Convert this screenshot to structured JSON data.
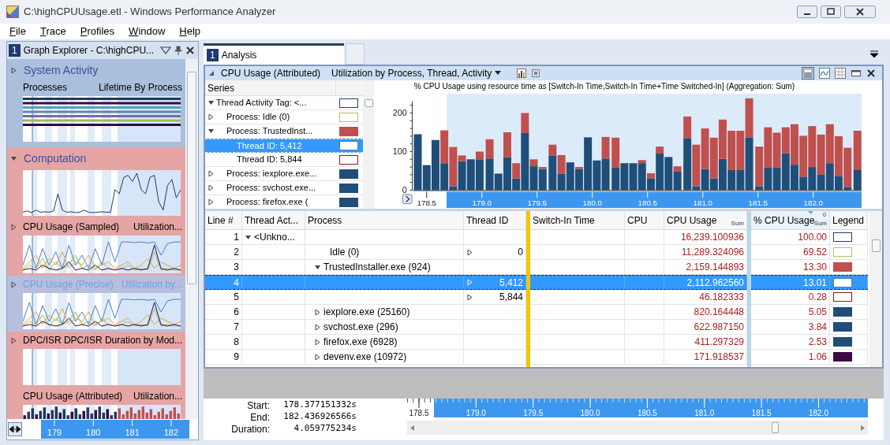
{
  "window": {
    "title": "C:\\highCPUUsage.etl - Windows Performance Analyzer"
  },
  "menu": [
    "File",
    "Trace",
    "Profiles",
    "Window",
    "Help"
  ],
  "graph_explorer": {
    "number": "1",
    "title": "Graph Explorer - C:\\highCPU...",
    "groups": [
      {
        "title": "System Activity",
        "expanded": false,
        "color": "#a9bfdc",
        "graphs": [
          {
            "name": "Processes",
            "preset": "Lifetime By Process",
            "expandable": false,
            "selected": false,
            "kind": "lifetime"
          }
        ]
      },
      {
        "title": "Computation",
        "expanded": true,
        "color": "#e6a5a5",
        "graphs": [
          {
            "expandable": false,
            "selected": false,
            "kind": "line"
          },
          {
            "name": "CPU Usage (Sampled)",
            "preset": "Utilization...",
            "expandable": true,
            "selected": false,
            "kind": "multiline"
          },
          {
            "name": "CPU Usage (Precise)",
            "preset": "Utilization by...",
            "expandable": true,
            "selected": true,
            "kind": "multiline"
          },
          {
            "name": "DPC/ISR",
            "preset": "DPC/ISR Duration by Mod...",
            "expandable": true,
            "selected": false,
            "kind": "empty"
          },
          {
            "name": "CPU Usage (Attributed)",
            "preset": "Utilization...",
            "expandable": false,
            "selected": false,
            "kind": "bars"
          }
        ]
      }
    ],
    "axis_ticks": [
      "179",
      "180",
      "181",
      "182"
    ]
  },
  "analysis_tab": {
    "number": "1",
    "label": "Analysis",
    "selected": true
  },
  "panel": {
    "title": "CPU Usage (Attributed)",
    "preset": "Utilization by Process, Thread, Activity",
    "series_header": "Series",
    "series": [
      {
        "label": "Thread Activity Tag: <...",
        "expanded": true,
        "selected": false,
        "color": "#1f3f6f",
        "filled": false,
        "children": [
          {
            "label": "Process: Idle (0)",
            "expanded": false,
            "selected": false,
            "color": "#b5bd6e",
            "filled": false
          },
          {
            "label": "Process: TrustedInst...",
            "expanded": true,
            "selected": false,
            "color": "#c0504d",
            "filled": true,
            "children": [
              {
                "label": "Thread ID: 5,412",
                "selected": true,
                "color": "#4a7ebb",
                "filled": false
              },
              {
                "label": "Thread ID: 5,844",
                "selected": false,
                "color": "#8b1a1a",
                "filled": false
              }
            ]
          },
          {
            "label": "Process: iexplore.exe...",
            "expanded": false,
            "selected": false,
            "color": "#1f4e79",
            "filled": true
          },
          {
            "label": "Process: svchost.exe...",
            "expanded": false,
            "selected": false,
            "color": "#1f4e79",
            "filled": true
          },
          {
            "label": "Process: firefox.exe (",
            "expanded": false,
            "selected": false,
            "color": "#1f4e79",
            "filled": true
          }
        ]
      }
    ],
    "chart_data": {
      "type": "bar",
      "stacked": true,
      "title": "% CPU Usage using resource time as [Switch-In Time,Switch-In Time+Time Switched-In] (Aggregation: Sum)",
      "x": [
        178.42,
        178.5,
        178.58,
        178.66,
        178.74,
        178.82,
        178.9,
        178.98,
        179.07,
        179.15,
        179.23,
        179.31,
        179.39,
        179.47,
        179.55,
        179.64,
        179.72,
        179.8,
        179.88,
        179.96,
        180.04,
        180.12,
        180.21,
        180.29,
        180.37,
        180.45,
        180.53,
        180.61,
        180.69,
        180.77,
        180.86,
        180.94,
        181.02,
        181.1,
        181.18,
        181.26,
        181.34,
        181.42,
        181.51,
        181.59,
        181.67,
        181.75,
        181.83,
        181.91,
        181.99,
        182.07,
        182.15,
        182.23,
        182.31,
        182.4
      ],
      "xlim": [
        178.377,
        182.437
      ],
      "ylim": [
        0,
        250
      ],
      "yticks": [
        0,
        100,
        200
      ],
      "xticks": [
        {
          "value": 178.5,
          "label": "178.5"
        },
        {
          "value": 179,
          "label": "179.0"
        },
        {
          "value": 179.5,
          "label": "179.5"
        },
        {
          "value": 180,
          "label": "180.0"
        },
        {
          "value": 180.5,
          "label": "180.5"
        },
        {
          "value": 181,
          "label": "181.0"
        },
        {
          "value": 181.5,
          "label": "181.5"
        },
        {
          "value": 182,
          "label": "182.0"
        }
      ],
      "series": [
        {
          "color": "#1f4e79",
          "values": [
            145,
            65,
            130,
            70,
            10,
            75,
            80,
            80,
            82,
            43,
            85,
            30,
            148,
            62,
            55,
            90,
            42,
            72,
            55,
            137,
            77,
            82,
            58,
            70,
            70,
            70,
            31,
            95,
            86,
            48,
            135,
            10,
            55,
            30,
            81,
            52,
            52,
            137,
            10,
            58,
            58,
            96,
            66,
            35,
            60,
            40,
            70,
            37,
            8,
            52
          ]
        },
        {
          "color": "#c0504d",
          "values": [
            0,
            0,
            0,
            85,
            102,
            15,
            0,
            20,
            50,
            0,
            65,
            40,
            52,
            18,
            5,
            28,
            49,
            0,
            5,
            0,
            0,
            56,
            78,
            0,
            0,
            8,
            13,
            18,
            0,
            14,
            56,
            108,
            105,
            106,
            102,
            102,
            102,
            101,
            103,
            105,
            91,
            67,
            105,
            106,
            106,
            104,
            101,
            103,
            102,
            102
          ]
        }
      ]
    }
  },
  "table": {
    "columns": [
      {
        "label": "Line #",
        "sorted": false
      },
      {
        "label": "Thread Act...",
        "sorted": false
      },
      {
        "label": "Process",
        "sorted": false
      },
      {
        "label": "Thread ID",
        "sorted": false
      },
      {
        "label": "Switch-In Time",
        "sorted": false
      },
      {
        "label": "CPU",
        "sorted": false
      },
      {
        "label": "CPU Usage",
        "aggregation": "Sum",
        "sorted": false
      },
      {
        "label": "% CPU Usage",
        "aggregation": "Sum",
        "sort_rank": "0",
        "sorted": true
      },
      {
        "label": "Legend",
        "sorted": false
      }
    ],
    "rows": [
      {
        "line": "1",
        "thread_activity": {
          "text": "<Unkno...",
          "expanded": true
        },
        "cpu_usage": "16,239.100936",
        "percent": "100.00",
        "color": "#1f3f6f",
        "filled": false,
        "selected": false
      },
      {
        "line": "2",
        "process": "Idle (0)",
        "thread_id": {
          "text": "0",
          "expanded": false
        },
        "cpu_usage": "11,289.324096",
        "percent": "69.52",
        "color": "#b5bd6e",
        "filled": false,
        "selected": false
      },
      {
        "line": "3",
        "process": {
          "text": "TrustedInstaller.exe (924)",
          "expanded": true
        },
        "cpu_usage": "2,159.144893",
        "percent": "13.30",
        "color": "#c0504d",
        "filled": true,
        "selected": false
      },
      {
        "line": "4",
        "thread_id": {
          "text": "5,412",
          "expanded": false
        },
        "cpu_usage": "2,112.962560",
        "percent": "13.01",
        "color": "#4a7ebb",
        "filled": false,
        "selected": true
      },
      {
        "line": "5",
        "thread_id": {
          "text": "5,844",
          "expanded": false
        },
        "cpu_usage": "46.182333",
        "percent": "0.28",
        "color": "#8b1a1a",
        "filled": false,
        "selected": false
      },
      {
        "line": "6",
        "process": {
          "text": "iexplore.exe (25160)",
          "expanded": false
        },
        "cpu_usage": "820.164448",
        "percent": "5.05",
        "color": "#1f4e79",
        "filled": true,
        "selected": false
      },
      {
        "line": "7",
        "process": {
          "text": "svchost.exe (296)",
          "expanded": false
        },
        "cpu_usage": "622.987150",
        "percent": "3.84",
        "color": "#1f4e79",
        "filled": true,
        "selected": false
      },
      {
        "line": "8",
        "process": {
          "text": "firefox.exe (6928)",
          "expanded": false
        },
        "cpu_usage": "411.297329",
        "percent": "2.53",
        "color": "#1f4e79",
        "filled": true,
        "selected": false
      },
      {
        "line": "9",
        "process": {
          "text": "devenv.exe (10972)",
          "expanded": false
        },
        "cpu_usage": "171.918537",
        "percent": "1.06",
        "color": "#3b0a45",
        "filled": true,
        "selected": false
      }
    ]
  },
  "timeline": {
    "fields": [
      {
        "label": "Start:",
        "value": "178.377151332s"
      },
      {
        "label": "End:",
        "value": "182.436926566s"
      },
      {
        "label": "Duration:",
        "value": "4.059775234s"
      }
    ],
    "ticks": [
      "178.5",
      "179.0",
      "179.5",
      "180.0",
      "180.5",
      "181.0",
      "181.5",
      "182.0"
    ]
  }
}
